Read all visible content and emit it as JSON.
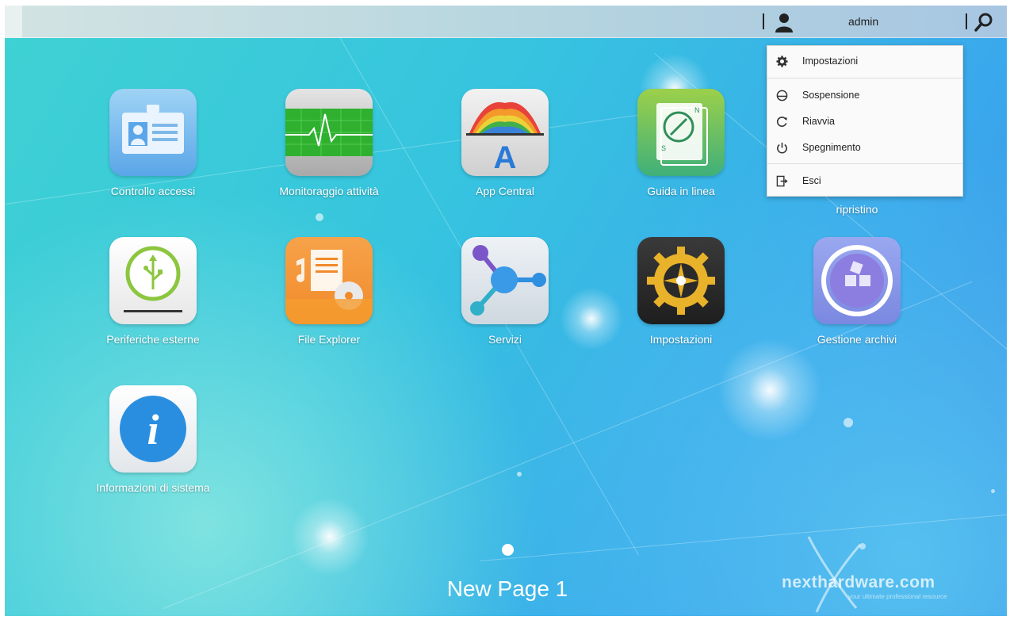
{
  "topbar": {
    "username": "admin"
  },
  "user_menu": {
    "items": [
      {
        "label": "Impostazioni",
        "icon": "gear-icon"
      },
      {
        "label": "Sospensione",
        "icon": "sleep-icon"
      },
      {
        "label": "Riavvia",
        "icon": "restart-icon"
      },
      {
        "label": "Spegnimento",
        "icon": "power-icon"
      },
      {
        "label": "Esci",
        "icon": "logout-icon"
      }
    ]
  },
  "apps": [
    {
      "label": "Controllo accessi",
      "icon": "id-card-icon"
    },
    {
      "label": "Monitoraggio attività",
      "icon": "activity-monitor-icon"
    },
    {
      "label": "App Central",
      "icon": "app-central-icon"
    },
    {
      "label": "Guida in linea",
      "icon": "compass-book-icon"
    },
    {
      "label": "ripristino",
      "icon": "restore-icon"
    },
    {
      "label": "Periferiche esterne",
      "icon": "usb-drive-icon"
    },
    {
      "label": "File Explorer",
      "icon": "file-explorer-icon"
    },
    {
      "label": "Servizi",
      "icon": "services-icon"
    },
    {
      "label": "Impostazioni",
      "icon": "settings-gear-icon"
    },
    {
      "label": "Gestione archivi",
      "icon": "storage-manager-icon"
    },
    {
      "label": "Informazioni di sistema",
      "icon": "info-icon"
    }
  ],
  "pager": {
    "page_label": "New Page 1"
  },
  "watermark": {
    "text": "nexthardware.com",
    "tagline": "your ultimate professional resource"
  }
}
